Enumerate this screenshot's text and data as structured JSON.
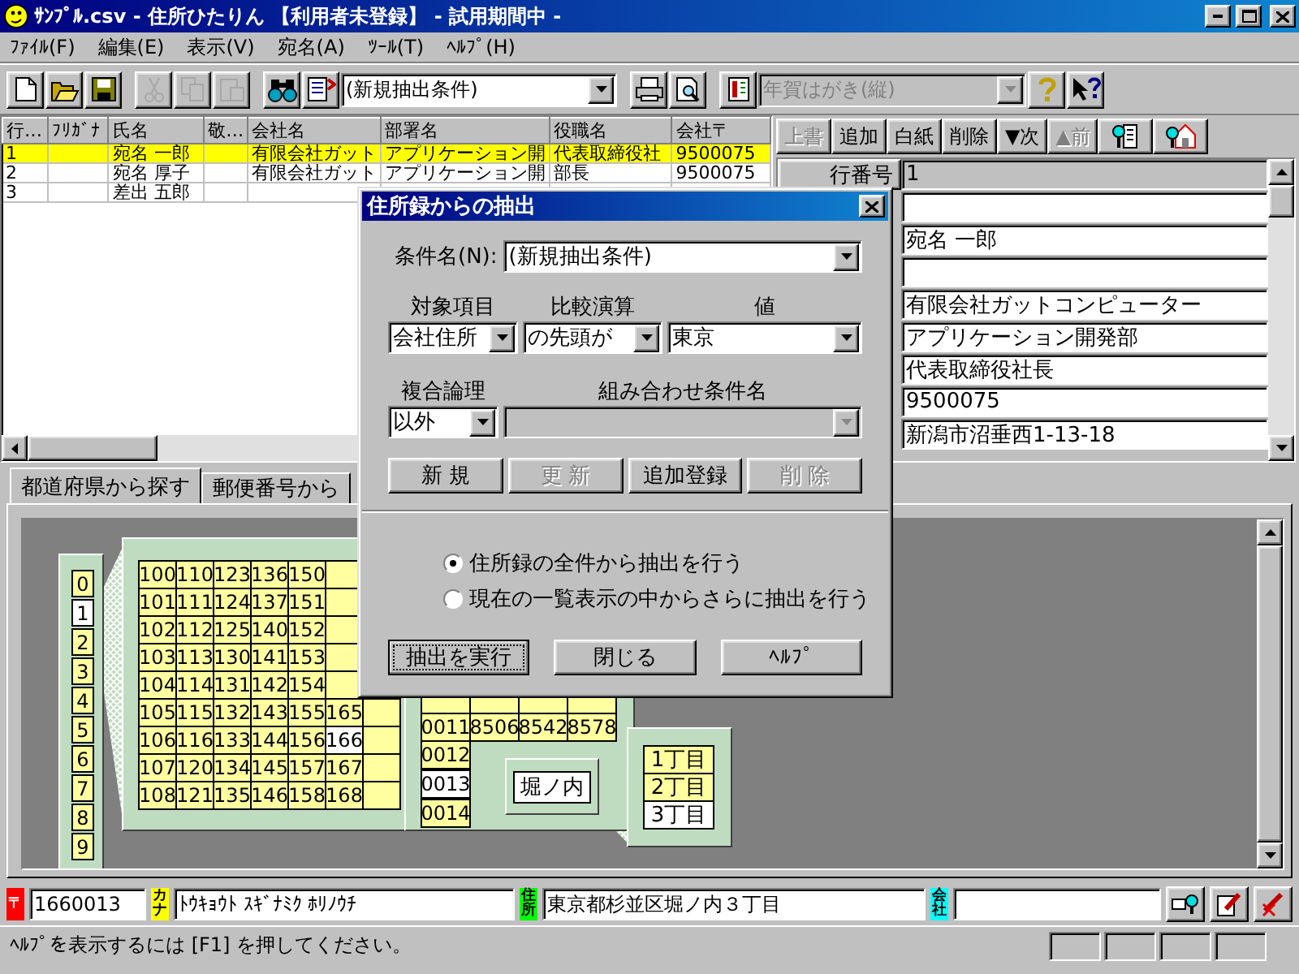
{
  "window": {
    "title": "ｻﾝﾌﾟﾙ.csv - 住所ひたりん 【利用者未登録】 - 試用期間中 -"
  },
  "menu": [
    "ﾌｧｲﾙ(F)",
    "編集(E)",
    "表示(V)",
    "宛名(A)",
    "ﾂｰﾙ(T)",
    "ﾍﾙﾌﾟ(H)"
  ],
  "toolbar": {
    "groups": [
      [
        {
          "kind": "new",
          "disabled": false
        },
        {
          "kind": "open",
          "disabled": false
        },
        {
          "kind": "save",
          "disabled": false
        }
      ],
      [
        {
          "kind": "cut",
          "disabled": true
        },
        {
          "kind": "copy",
          "disabled": true
        },
        {
          "kind": "paste",
          "disabled": true
        }
      ],
      [
        {
          "kind": "find",
          "disabled": false
        },
        {
          "kind": "extract",
          "disabled": false
        },
        {
          "kind": "combo",
          "value": "(新規抽出条件)",
          "disabled": false
        }
      ],
      [
        {
          "kind": "print",
          "disabled": false
        },
        {
          "kind": "preview",
          "disabled": false
        }
      ],
      [
        {
          "kind": "card",
          "disabled": false
        },
        {
          "kind": "combo",
          "value": "年賀はがき(縦)",
          "disabled": true
        },
        {
          "kind": "help",
          "disabled": false
        },
        {
          "kind": "context_help",
          "disabled": false
        }
      ]
    ]
  },
  "table": {
    "columns": [
      "行…",
      "ﾌﾘｶﾞﾅ",
      "氏名",
      "敬…",
      "会社名",
      "部署名",
      "役職名",
      "会社〒"
    ],
    "rows": [
      {
        "selected": true,
        "cells": [
          "1",
          "",
          "宛名 一郎",
          "",
          "有限会社ガット",
          "アプリケーション開",
          "代表取締役社",
          "9500075"
        ]
      },
      {
        "selected": false,
        "cells": [
          "2",
          "",
          "宛名 厚子",
          "",
          "有限会社ガット",
          "アプリケーション開",
          "部長",
          "9500075"
        ]
      },
      {
        "selected": false,
        "cells": [
          "3",
          "",
          "差出 五郎",
          "",
          "",
          "",
          "",
          ""
        ]
      }
    ]
  },
  "record": {
    "buttons": [
      {
        "kind": "text",
        "label": "上書",
        "disabled": true
      },
      {
        "kind": "text",
        "label": "追加",
        "disabled": false
      },
      {
        "kind": "text",
        "label": "白紙",
        "disabled": false
      },
      {
        "kind": "text",
        "label": "削除",
        "disabled": false
      },
      {
        "kind": "text",
        "label": "▼次",
        "disabled": false
      },
      {
        "kind": "text",
        "label": "▲前",
        "disabled": true
      },
      {
        "kind": "company_search",
        "disabled": false
      },
      {
        "kind": "home_search",
        "disabled": false
      }
    ],
    "row_label": "行番号",
    "fields": [
      {
        "value": "1",
        "readonly": true
      },
      {
        "readonly": false
      },
      {
        "value": "宛名 一郎",
        "readonly": false
      },
      {
        "readonly": false
      },
      {
        "value": "有限会社ガットコンピューター",
        "readonly": false
      },
      {
        "value": "アプリケーション開発部",
        "readonly": false
      },
      {
        "value": "代表取締役社長",
        "readonly": false
      },
      {
        "value": "9500075",
        "readonly": false
      },
      {
        "value": "新潟市沼垂西1-13-18",
        "readonly": false
      }
    ]
  },
  "search_tabs": [
    {
      "label": "都道府県から探す",
      "selected": true
    },
    {
      "label": "郵便番号から",
      "selected": false
    }
  ],
  "postal_map": {
    "digits": [
      {
        "label": "0",
        "selected": false
      },
      {
        "label": "1",
        "selected": true
      },
      {
        "label": "2",
        "selected": false
      },
      {
        "label": "3",
        "selected": false
      },
      {
        "label": "4",
        "selected": false
      },
      {
        "label": "5",
        "selected": false
      },
      {
        "label": "6",
        "selected": false
      },
      {
        "label": "7",
        "selected": false
      },
      {
        "label": "8",
        "selected": false
      },
      {
        "label": "9",
        "selected": false
      }
    ],
    "areas": [
      [
        {
          "label": "100",
          "selected": false
        },
        {
          "label": "110",
          "selected": false
        },
        {
          "label": "123",
          "selected": false
        },
        {
          "label": "136",
          "selected": false
        },
        {
          "label": "150",
          "selected": false
        }
      ],
      [
        {
          "label": "101",
          "selected": false
        },
        {
          "label": "111",
          "selected": false
        },
        {
          "label": "124",
          "selected": false
        },
        {
          "label": "137",
          "selected": false
        },
        {
          "label": "151",
          "selected": false
        }
      ],
      [
        {
          "label": "102",
          "selected": false
        },
        {
          "label": "112",
          "selected": false
        },
        {
          "label": "125",
          "selected": false
        },
        {
          "label": "140",
          "selected": false
        },
        {
          "label": "152",
          "selected": false
        }
      ],
      [
        {
          "label": "103",
          "selected": false
        },
        {
          "label": "113",
          "selected": false
        },
        {
          "label": "130",
          "selected": false
        },
        {
          "label": "141",
          "selected": false
        },
        {
          "label": "153",
          "selected": false
        }
      ],
      [
        {
          "label": "104",
          "selected": false
        },
        {
          "label": "114",
          "selected": false
        },
        {
          "label": "131",
          "selected": false
        },
        {
          "label": "142",
          "selected": false
        },
        {
          "label": "154",
          "selected": false
        }
      ],
      [
        {
          "label": "105",
          "selected": false
        },
        {
          "label": "115",
          "selected": false
        },
        {
          "label": "132",
          "selected": false
        },
        {
          "label": "143",
          "selected": false
        },
        {
          "label": "155",
          "selected": false
        },
        {
          "label": "165",
          "selected": false
        }
      ],
      [
        {
          "label": "106",
          "selected": false
        },
        {
          "label": "116",
          "selected": false
        },
        {
          "label": "133",
          "selected": false
        },
        {
          "label": "144",
          "selected": false
        },
        {
          "label": "156",
          "selected": false
        },
        {
          "label": "166",
          "selected": true
        }
      ],
      [
        {
          "label": "107",
          "selected": false
        },
        {
          "label": "120",
          "selected": false
        },
        {
          "label": "134",
          "selected": false
        },
        {
          "label": "145",
          "selected": false
        },
        {
          "label": "157",
          "selected": false
        },
        {
          "label": "167",
          "selected": false
        }
      ],
      [
        {
          "label": "108",
          "selected": false
        },
        {
          "label": "121",
          "selected": false
        },
        {
          "label": "135",
          "selected": false
        },
        {
          "label": "146",
          "selected": false
        },
        {
          "label": "158",
          "selected": false
        },
        {
          "label": "168",
          "selected": false
        }
      ]
    ],
    "codes": [
      [
        {
          "label": "0011",
          "selected": false
        },
        {
          "label": "8506",
          "selected": false
        },
        {
          "label": "8542",
          "selected": false
        },
        {
          "label": "8578",
          "selected": false
        }
      ],
      [
        {
          "label": "0012",
          "selected": false
        }
      ],
      [
        {
          "label": "0013",
          "selected": true
        }
      ],
      [
        {
          "label": "0014",
          "selected": false
        }
      ]
    ],
    "town": "堀ノ内",
    "districts": [
      {
        "label": "1丁目",
        "selected": false
      },
      {
        "label": "2丁目",
        "selected": false
      },
      {
        "label": "3丁目",
        "selected": true
      }
    ]
  },
  "dialog": {
    "title": "住所録からの抽出",
    "condition_label": "条件名(N):",
    "condition": "(新規抽出条件)",
    "target_label": "対象項目",
    "operator_label": "比較演算",
    "value_label": "値",
    "target": "会社住所",
    "operator": "の先頭が",
    "value": "東京",
    "logic_label": "複合論理",
    "combine_label": "組み合わせ条件名",
    "logic": "以外",
    "actions": [
      {
        "label": "新 規",
        "disabled": false
      },
      {
        "label": "更 新",
        "disabled": true
      },
      {
        "label": "追加登録",
        "disabled": false
      },
      {
        "label": "削 除",
        "disabled": true
      }
    ],
    "scope": [
      {
        "label": "住所録の全件から抽出を行う",
        "selected": true
      },
      {
        "label": "現在の一覧表示の中からさらに抽出を行う",
        "selected": false
      }
    ],
    "buttons": [
      {
        "label": "抽出を実行",
        "focused": true
      },
      {
        "label": "閉じる",
        "focused": false
      },
      {
        "label": "ﾍﾙﾌﾟ",
        "focused": false
      }
    ]
  },
  "address_bar": {
    "zip_tag": "〒",
    "zip": "1660013",
    "kana_tag": "カナ",
    "kana": "ﾄｳｷｮｳﾄ ｽｷﾞﾅﾐｸ ﾎﾘﾉｳﾁ",
    "address_tag": "住所",
    "address": "東京都杉並区堀ノ内３丁目",
    "company_tag": "会社"
  },
  "status_bar": {
    "text": "ﾍﾙﾌﾟを表示するには [F1] を押してください。"
  }
}
